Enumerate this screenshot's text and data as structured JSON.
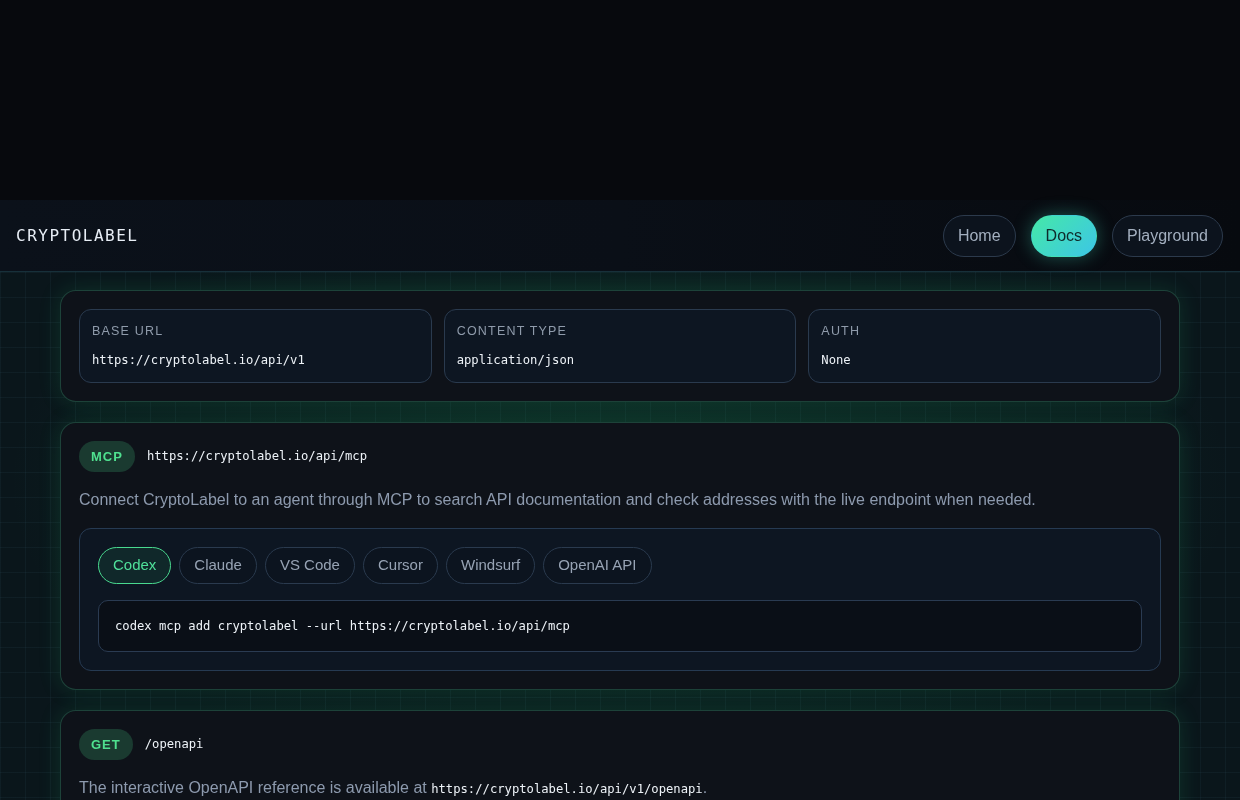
{
  "header": {
    "brand": "CRYPTOLABEL",
    "nav": [
      {
        "label": "Home",
        "selected": false
      },
      {
        "label": "Docs",
        "selected": true
      },
      {
        "label": "Playground",
        "selected": false
      }
    ]
  },
  "overview": {
    "fields": [
      {
        "label": "BASE URL",
        "value": "https://cryptolabel.io/api/v1"
      },
      {
        "label": "CONTENT TYPE",
        "value": "application/json"
      },
      {
        "label": "AUTH",
        "value": "None"
      }
    ]
  },
  "endpoints": [
    {
      "method": "MCP",
      "path": "https://cryptolabel.io/api/mcp",
      "description": [
        {
          "kind": "text",
          "text": "Connect CryptoLabel to an agent through MCP to search API documentation and check addresses with the live endpoint when needed."
        }
      ],
      "clients": {
        "tabs": [
          {
            "label": "Codex",
            "selected": true
          },
          {
            "label": "Claude",
            "selected": false
          },
          {
            "label": "VS Code",
            "selected": false
          },
          {
            "label": "Cursor",
            "selected": false
          },
          {
            "label": "Windsurf",
            "selected": false
          },
          {
            "label": "OpenAI API",
            "selected": false
          }
        ],
        "command": "codex mcp add cryptolabel --url https://cryptolabel.io/api/mcp"
      }
    },
    {
      "method": "GET",
      "path": "/openapi",
      "description": [
        {
          "kind": "text",
          "text": "The interactive OpenAPI reference is available at "
        },
        {
          "kind": "code",
          "text": "https://cryptolabel.io/api/v1/openapi"
        },
        {
          "kind": "text",
          "text": "."
        }
      ]
    }
  ]
}
